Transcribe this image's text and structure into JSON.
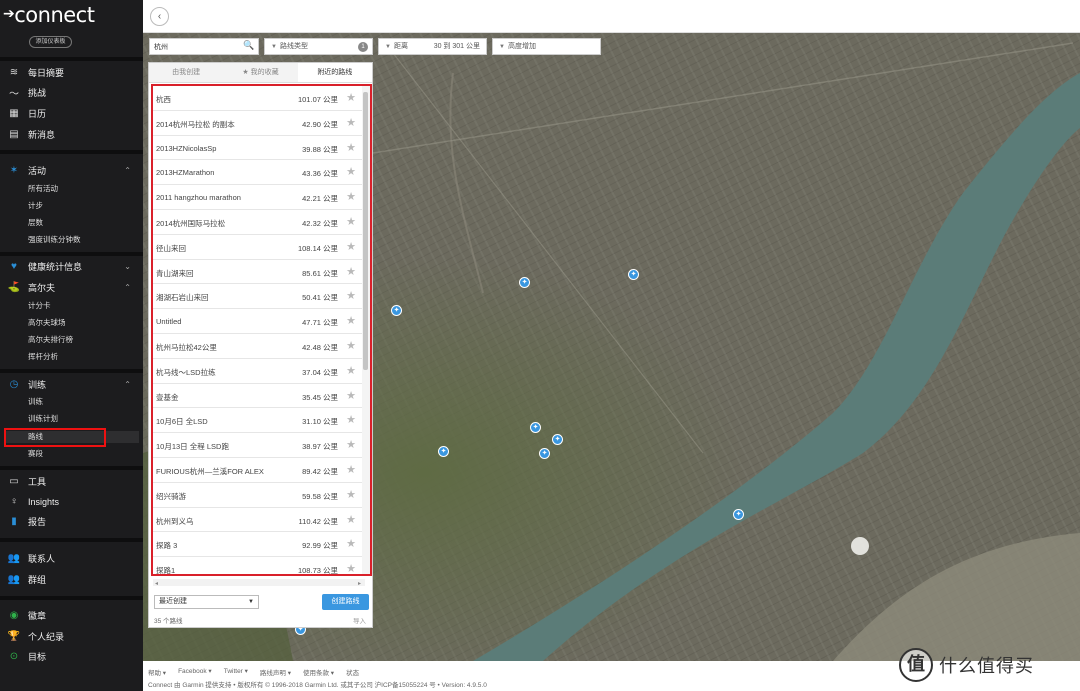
{
  "app": {
    "logo": "connect",
    "add_dashboard": "添加仪表板"
  },
  "sidebar": {
    "top_items": [
      {
        "icon": "layers-icon",
        "label": "每日摘要"
      },
      {
        "icon": "challenge-icon",
        "label": "挑战"
      },
      {
        "icon": "calendar-icon",
        "label": "日历"
      },
      {
        "icon": "news-icon",
        "label": "新消息"
      }
    ],
    "activity": {
      "label": "活动",
      "subs": [
        "所有活动",
        "计步",
        "层数",
        "强度训练分钟数"
      ]
    },
    "health": {
      "label": "健康统计信息"
    },
    "golf": {
      "label": "高尔夫",
      "subs": [
        "计分卡",
        "高尔夫球场",
        "高尔夫排行榜",
        "挥杆分析"
      ]
    },
    "training": {
      "label": "训练",
      "subs": [
        "训练",
        "训练计划",
        "路线",
        "赛段"
      ]
    },
    "tools": [
      {
        "icon": "tools-icon",
        "label": "工具"
      },
      {
        "icon": "bulb-icon",
        "label": "Insights"
      },
      {
        "icon": "report-icon",
        "label": "报告"
      }
    ],
    "social": [
      {
        "icon": "contacts-icon",
        "label": "联系人"
      },
      {
        "icon": "groups-icon",
        "label": "群组"
      }
    ],
    "achievements": [
      {
        "icon": "badge-icon",
        "label": "徽章"
      },
      {
        "icon": "trophy-icon",
        "label": "个人纪录"
      },
      {
        "icon": "target-icon",
        "label": "目标"
      }
    ]
  },
  "filters": {
    "search_value": "杭州",
    "route_type": "路线类型",
    "route_type_count": "1",
    "distance_label": "距离",
    "distance_value": "30 到 301 公里",
    "elevation_label": "高度增加"
  },
  "panel": {
    "tabs": [
      "由我创建",
      "我的收藏",
      "附近的路线"
    ],
    "active_tab": 2,
    "routes": [
      {
        "name": "杭西",
        "distance": "101.07 公里"
      },
      {
        "name": "2014杭州马拉松 的副本",
        "distance": "42.90 公里"
      },
      {
        "name": "2013HZNicolasSp",
        "distance": "39.88 公里"
      },
      {
        "name": "2013HZMarathon",
        "distance": "43.36 公里"
      },
      {
        "name": "2011 hangzhou marathon",
        "distance": "42.21 公里"
      },
      {
        "name": "2014杭州国际马拉松",
        "distance": "42.32 公里"
      },
      {
        "name": "径山来回",
        "distance": "108.14 公里"
      },
      {
        "name": "青山湖来回",
        "distance": "85.61 公里"
      },
      {
        "name": "湘湖石岩山来回",
        "distance": "50.41 公里"
      },
      {
        "name": "Untitled",
        "distance": "47.71 公里"
      },
      {
        "name": "杭州马拉松42公里",
        "distance": "42.48 公里"
      },
      {
        "name": "杭马线～LSD拉练",
        "distance": "37.04 公里"
      },
      {
        "name": "壹基金",
        "distance": "35.45 公里"
      },
      {
        "name": "10月6日 全LSD",
        "distance": "31.10 公里"
      },
      {
        "name": "10月13日 全程 LSD跑",
        "distance": "38.97 公里"
      },
      {
        "name": "FURIOUS杭州—兰溪FOR ALEX",
        "distance": "89.42 公里"
      },
      {
        "name": "绍兴骑游",
        "distance": "59.58 公里"
      },
      {
        "name": "杭州到义乌",
        "distance": "110.42 公里"
      },
      {
        "name": "探路 3",
        "distance": "92.99 公里"
      },
      {
        "name": "探路1",
        "distance": "108.73 公里"
      }
    ],
    "sort_value": "最近创建",
    "create_button": "创建路线",
    "count": "35 个路线",
    "import": "导入"
  },
  "footer": {
    "links": [
      "帮助 ▾",
      "Facebook ▾",
      "Twitter ▾",
      "路线声明 ▾",
      "使用条款 ▾",
      "状态"
    ],
    "copyright": "Connect 由 Garmin    提供支持 • 版权所有 © 1996-2018 Garmin Ltd. 或其子公司    沪ICP备15055224    号 • Version: 4.9.5.0"
  },
  "watermark": {
    "logo": "值",
    "text": "什么值得买"
  },
  "colors": {
    "accent": "#3a97e0",
    "highlight": "#d9202a",
    "sidebar_bg": "#1c1c1e",
    "river": "#5b7c78"
  }
}
